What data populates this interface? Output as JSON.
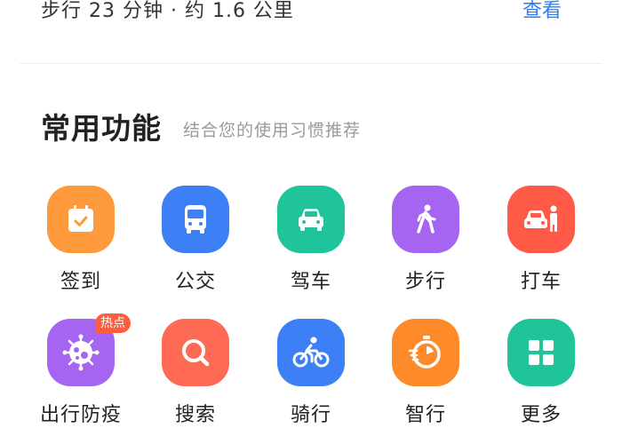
{
  "route": {
    "summary": "步行 23 分钟 · 约 1.6 公里",
    "link_label": "查看"
  },
  "section": {
    "title": "常用功能",
    "subtitle": "结合您的使用习惯推荐"
  },
  "colors": {
    "accent_blue": "#2f7bf5",
    "badge_red": "#ff5d3d"
  },
  "tiles": [
    {
      "label": "签到",
      "icon": "calendar-check-icon",
      "color": "#ff9a3c"
    },
    {
      "label": "公交",
      "icon": "bus-icon",
      "color": "#3d7ff5"
    },
    {
      "label": "驾车",
      "icon": "car-icon",
      "color": "#1fc49a"
    },
    {
      "label": "步行",
      "icon": "walking-person-icon",
      "color": "#a565f0"
    },
    {
      "label": "打车",
      "icon": "taxi-person-icon",
      "color": "#ff5a48"
    },
    {
      "label": "出行防疫",
      "icon": "virus-icon",
      "color": "#a565f0",
      "badge": "热点"
    },
    {
      "label": "搜索",
      "icon": "search-icon",
      "color": "#ff6a55"
    },
    {
      "label": "骑行",
      "icon": "bicycle-icon",
      "color": "#3d7ff5"
    },
    {
      "label": "智行",
      "icon": "stopwatch-icon",
      "color": "#ff8a2a"
    },
    {
      "label": "更多",
      "icon": "grid-more-icon",
      "color": "#1fc49a"
    }
  ]
}
